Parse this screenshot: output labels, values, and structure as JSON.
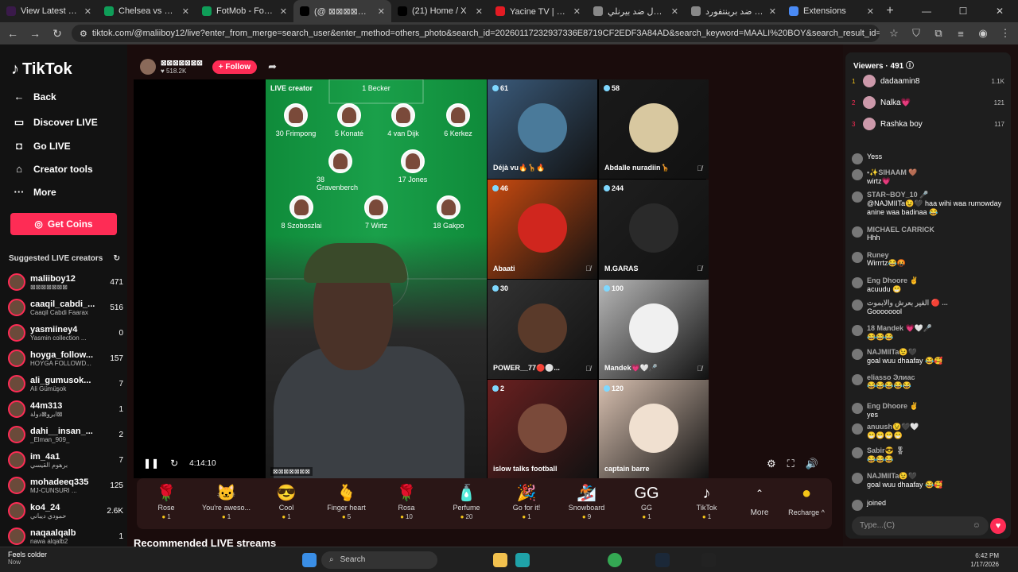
{
  "browser": {
    "tabs": [
      {
        "title": "View Latest suheyb te",
        "color": "#3a1a4a"
      },
      {
        "title": "Chelsea vs Brentford",
        "color": "#0f9d58"
      },
      {
        "title": "FotMob - Football Liv",
        "color": "#0f9d58"
      },
      {
        "title": "(@ ⊠⊠⊠⊠⊠⊠⊠",
        "color": "#000000"
      },
      {
        "title": "(21) Home / X",
        "color": "#000000"
      },
      {
        "title": "Yacine TV | جودة عالية",
        "color": "#e31b23"
      },
      {
        "title": "ليفربول ضد بيرنلي - /",
        "color": "#888888"
      },
      {
        "title": "تشيلسي ضد برينتفورد",
        "color": "#888888"
      },
      {
        "title": "Extensions",
        "color": "#4a8af4"
      }
    ],
    "url": "tiktok.com/@maliiboy12/live?enter_from_merge=search_user&enter_method=others_photo&search_id=20260117232937336E8719CF2EDF3A84AD&search_keyword=MAALI%20BOY&search_result_id=6727586638124048388&search_type=user"
  },
  "sidebar": {
    "logo": "TikTok",
    "nav": [
      {
        "label": "Back",
        "icon": "←"
      },
      {
        "label": "Discover LIVE",
        "icon": "▭"
      },
      {
        "label": "Go LIVE",
        "icon": "◘"
      },
      {
        "label": "Creator tools",
        "icon": "⌂"
      },
      {
        "label": "More",
        "icon": "···"
      }
    ],
    "coins_label": "Get Coins",
    "suggested_title": "Suggested LIVE creators",
    "creators": [
      {
        "name": "maliiboy12",
        "sub": "⊠⊠⊠⊠⊠⊠⊠",
        "count": "471"
      },
      {
        "name": "caaqil_cabdi_...",
        "sub": "Caaqil Cabdi Faarax",
        "count": "516"
      },
      {
        "name": "yasmiiney4",
        "sub": "Yasmin collection ...",
        "count": "0"
      },
      {
        "name": "hoyga_follow...",
        "sub": "HOYGA FOLLOWD...",
        "count": "157"
      },
      {
        "name": "ali_gumusok...",
        "sub": "Ali Gümüşok",
        "count": "7"
      },
      {
        "name": "44m313",
        "sub": "ابرو⊠دولة⊠",
        "count": "1"
      },
      {
        "name": "dahi__insan_...",
        "sub": "_Elman_909_",
        "count": "2"
      },
      {
        "name": "im_4a1",
        "sub": "برهوم القيسي",
        "count": "7"
      },
      {
        "name": "mohadeeq335",
        "sub": "MJ-CUNSURI ...",
        "count": "125"
      },
      {
        "name": "ko4_24",
        "sub": "حمودي ديباني",
        "count": "2.6K"
      },
      {
        "name": "naqaalqalb",
        "sub": "nawa alqalb2",
        "count": "1"
      }
    ]
  },
  "stream": {
    "host_name": "⊠⊠⊠⊠⊠⊠⊠",
    "host_likes": "518.2K",
    "follow_label": "+ Follow",
    "live_creator_label": "LIVE creator",
    "players": [
      {
        "name": "1 Becker"
      },
      {
        "name": "30 Frimpong"
      },
      {
        "name": "5 Konaté"
      },
      {
        "name": "4 van Dijk"
      },
      {
        "name": "6 Kerkez"
      },
      {
        "name": "38 Gravenberch"
      },
      {
        "name": "17 Jones"
      },
      {
        "name": "8 Szoboszlai"
      },
      {
        "name": "7 Wirtz"
      },
      {
        "name": "18 Gakpo"
      }
    ],
    "timer": "4:14:10",
    "host_tag": "⊠⊠⊠⊠⊠⊠⊠",
    "guests": [
      {
        "name": "Déjà vu🔥🦒🔥",
        "viewers": "61",
        "muted": false,
        "bg": "#3a5a7a",
        "circle": "#4a7a9a"
      },
      {
        "name": "Abdalle nuradiin🦒",
        "viewers": "58",
        "muted": true,
        "bg": "#1a1a1a",
        "circle": "#d8c8a0"
      },
      {
        "name": "Abaati",
        "viewers": "46",
        "muted": true,
        "bg": "#c84a10",
        "circle": "#d0261e"
      },
      {
        "name": "M.GARAS",
        "viewers": "244",
        "muted": true,
        "bg": "#1f1f1f",
        "circle": "#2a2a2a"
      },
      {
        "name": "POWER__77🔴⚪...",
        "viewers": "30",
        "muted": true,
        "bg": "#333333",
        "circle": "#5a3a2a"
      },
      {
        "name": "Mandek💗🤍🎤",
        "viewers": "100",
        "muted": true,
        "bg": "#b8b8b8",
        "circle": "#f0f0f0"
      },
      {
        "name": "islow talks football",
        "viewers": "2",
        "muted": false,
        "bg": "#6a2020",
        "circle": "#7a4a3a"
      },
      {
        "name": "captain barre",
        "viewers": "120",
        "muted": false,
        "bg": "#d8c0b0",
        "circle": "#f0e0d0"
      }
    ],
    "gifts": [
      {
        "label": "Rose",
        "price": "1",
        "icon": "🌹"
      },
      {
        "label": "You're aweso...",
        "price": "1",
        "icon": "🐱"
      },
      {
        "label": "Cool",
        "price": "1",
        "icon": "😎"
      },
      {
        "label": "Finger heart",
        "price": "5",
        "icon": "🫰"
      },
      {
        "label": "Rosa",
        "price": "10",
        "icon": "🌹"
      },
      {
        "label": "Perfume",
        "price": "20",
        "icon": "🧴"
      },
      {
        "label": "Go for it!",
        "price": "1",
        "icon": "🎉"
      },
      {
        "label": "Snowboard",
        "price": "9",
        "icon": "🏂"
      },
      {
        "label": "GG",
        "price": "1",
        "icon": "GG"
      },
      {
        "label": "TikTok",
        "price": "1",
        "icon": "♪"
      }
    ],
    "more_label": "More",
    "recharge_label": "Recharge ^",
    "recommended_title": "Recommended LIVE streams"
  },
  "chat": {
    "viewers_label": "Viewers · 491",
    "top_viewers": [
      {
        "rank": "1",
        "name": "dadaamin8",
        "count": "1.1K"
      },
      {
        "rank": "2",
        "name": "Nalka💗",
        "count": "121"
      },
      {
        "rank": "3",
        "name": "Rashka boy",
        "count": "117"
      }
    ],
    "messages": [
      {
        "user": "",
        "text": "Yess"
      },
      {
        "user": "•✨SIHAAM 🤎",
        "text": "wirtz💗"
      },
      {
        "user": "STAR~BOY_10 🎤",
        "text": "@NAJMIITa😉🖤 haa wihi waa rumowday anine waa badinaa 😂"
      },
      {
        "user": "MICHAEL CARRICK",
        "text": "Hhh"
      },
      {
        "user": "Runey",
        "text": "Wirrrtz😂🤬"
      },
      {
        "user": "Eng Dhoore ✌️",
        "text": "acuudu 😁"
      },
      {
        "user": "الفير بعرش والابموت 🔴 ...",
        "text": "Goooooool"
      },
      {
        "user": "18 Mandek 💗🤍🎤",
        "text": "😂😂😂"
      },
      {
        "user": "NAJMIITa😉🖤",
        "text": "goal wuu dhaafay 😂🥰"
      },
      {
        "user": "eliasso Элиас",
        "text": "😂😂😂😂😂"
      },
      {
        "user": "Eng Dhoore ✌️",
        "text": "yes"
      },
      {
        "user": "anuush😉🖤🤍",
        "text": "😁😁😁😁"
      },
      {
        "user": "Sabir😎 🎖",
        "text": "😂😂😂"
      },
      {
        "user": "NAJMIITa😉🖤",
        "text": "goal wuu dhaafay 😂🥰"
      },
      {
        "user": "",
        "text": "joined"
      }
    ],
    "input_placeholder": "Type...(C)"
  },
  "taskbar": {
    "weather_title": "Feels colder",
    "weather_sub": "Now",
    "search_label": "Search",
    "time": "6:42 PM",
    "date": "1/17/2026"
  }
}
